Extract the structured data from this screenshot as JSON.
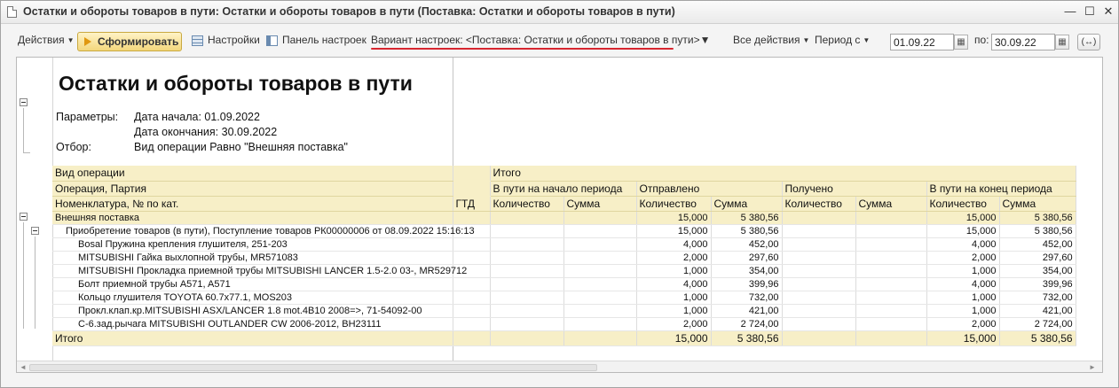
{
  "window": {
    "title": "Остатки и обороты товаров в пути: Остатки и обороты товаров в пути (Поставка: Остатки и обороты товаров в пути)",
    "minimize": "—",
    "maximize": "☐",
    "close": "✕"
  },
  "toolbar": {
    "actions": "Действия",
    "run": "Сформировать",
    "settings": "Настройки",
    "panel": "Панель настроек",
    "variant": "Вариант настроек: <Поставка: Остатки и обороты товаров в пути>",
    "all_actions": "Все действия",
    "period_from": "Период с",
    "date_from": "01.09.22",
    "to_label": "по:",
    "date_to": "30.09.22",
    "dots": "(↔)"
  },
  "report": {
    "title": "Остатки и обороты товаров в пути",
    "params_label": "Параметры:",
    "date_start": "Дата начала: 01.09.2022",
    "date_end": "Дата окончания: 30.09.2022",
    "filter_label": "Отбор:",
    "filter_value": "Вид операции Равно \"Внешняя поставка\"",
    "headers": {
      "h1_c1": "Вид операции",
      "h1_total": "Итого",
      "h2_c1": "Операция, Партия",
      "start": "В пути на начало периода",
      "sent": "Отправлено",
      "received": "Получено",
      "end": "В пути на конец периода",
      "h3_c1": "Номенклатура, № по кат.",
      "gtd": "ГТД",
      "qty": "Количество",
      "sum": "Сумма"
    },
    "rows": [
      {
        "name": "Внешняя поставка",
        "sent_qty": "15,000",
        "sent_sum": "5 380,56",
        "end_qty": "15,000",
        "end_sum": "5 380,56"
      },
      {
        "name": "Приобретение товаров (в пути), Поступление товаров РК00000006 от 08.09.2022 15:16:13",
        "sent_qty": "15,000",
        "sent_sum": "5 380,56",
        "end_qty": "15,000",
        "end_sum": "5 380,56"
      },
      {
        "name": "Bosal Пружина крепления глушителя, 251-203",
        "sent_qty": "4,000",
        "sent_sum": "452,00",
        "end_qty": "4,000",
        "end_sum": "452,00"
      },
      {
        "name": "MITSUBISHI Гайка выхлопной трубы, MR571083",
        "sent_qty": "2,000",
        "sent_sum": "297,60",
        "end_qty": "2,000",
        "end_sum": "297,60"
      },
      {
        "name": "MITSUBISHI Прокладка приемной трубы MITSUBISHI LANCER 1.5-2.0 03-, MR529712",
        "sent_qty": "1,000",
        "sent_sum": "354,00",
        "end_qty": "1,000",
        "end_sum": "354,00"
      },
      {
        "name": "Болт приемной трубы A571, A571",
        "sent_qty": "4,000",
        "sent_sum": "399,96",
        "end_qty": "4,000",
        "end_sum": "399,96"
      },
      {
        "name": "Кольцо глушителя TOYOTA 60.7x77.1, MOS203",
        "sent_qty": "1,000",
        "sent_sum": "732,00",
        "end_qty": "1,000",
        "end_sum": "732,00"
      },
      {
        "name": "Прокл.клап.кр.MITSUBISHI ASX/LANCER 1.8 mot.4B10 2008=>, 71-54092-00",
        "sent_qty": "1,000",
        "sent_sum": "421,00",
        "end_qty": "1,000",
        "end_sum": "421,00"
      },
      {
        "name": "С-6.зад.рычага MITSUBISHI OUTLANDER CW 2006-2012, BH23111",
        "sent_qty": "2,000",
        "sent_sum": "2 724,00",
        "end_qty": "2,000",
        "end_sum": "2 724,00"
      }
    ],
    "total": {
      "name": "Итого",
      "sent_qty": "15,000",
      "sent_sum": "5 380,56",
      "end_qty": "15,000",
      "end_sum": "5 380,56"
    }
  },
  "scroll": {
    "up": "▲",
    "down": "▼",
    "left": "◄",
    "right": "►"
  }
}
